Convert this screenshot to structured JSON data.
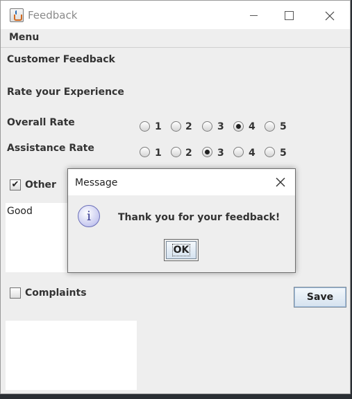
{
  "window": {
    "title": "Feedback",
    "app_icon": "java-cup-icon"
  },
  "menubar": {
    "items": [
      {
        "label": "Menu"
      }
    ]
  },
  "form": {
    "heading": "Customer Feedback",
    "subheading": "Rate your Experience",
    "overall": {
      "label": "Overall Rate",
      "options": [
        "1",
        "2",
        "3",
        "4",
        "5"
      ],
      "selected": "4"
    },
    "assistance": {
      "label": "Assistance Rate",
      "options": [
        "1",
        "2",
        "3",
        "4",
        "5"
      ],
      "selected": "3"
    },
    "other": {
      "label": "Other",
      "checked": true,
      "text": "Good"
    },
    "complaints": {
      "label": "Complaints",
      "checked": false,
      "text": ""
    },
    "save_label": "Save"
  },
  "dialog": {
    "title": "Message",
    "icon": "info-icon",
    "message": "Thank you for your feedback!",
    "ok_label": "OK"
  }
}
